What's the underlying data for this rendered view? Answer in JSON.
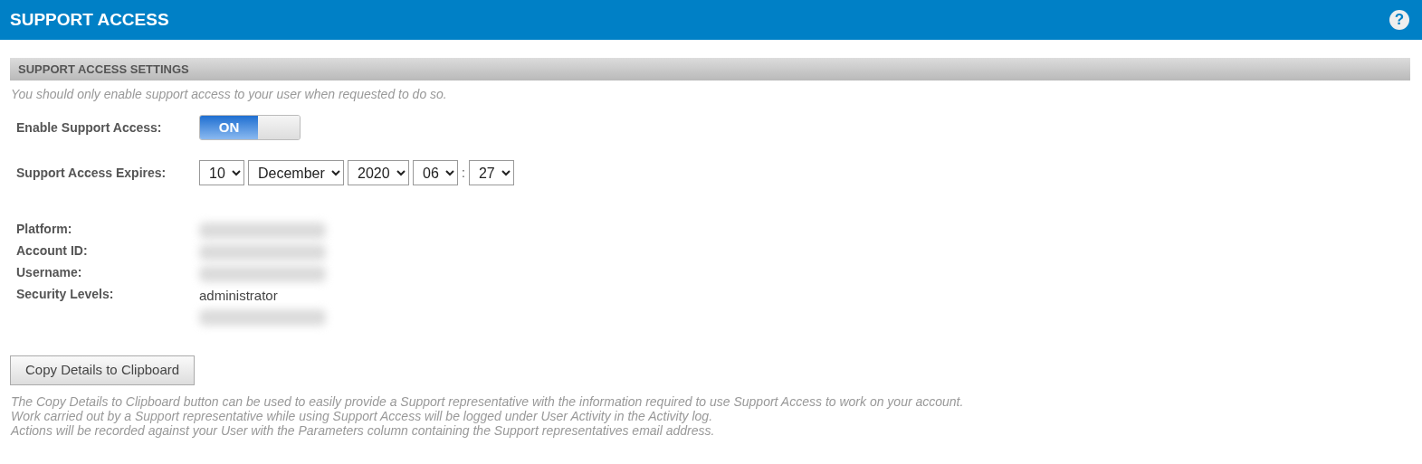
{
  "header": {
    "title": "SUPPORT ACCESS",
    "help": "?"
  },
  "section": {
    "title": "SUPPORT ACCESS SETTINGS",
    "note": "You should only enable support access to your user when requested to do so."
  },
  "enable": {
    "label": "Enable Support Access:",
    "on": true,
    "on_text": "ON"
  },
  "expires": {
    "label": "Support Access Expires:",
    "separator": ":",
    "selects": [
      {
        "value": "10"
      },
      {
        "value": "December"
      },
      {
        "value": "2020"
      },
      {
        "value": "06"
      },
      {
        "value": "27"
      }
    ]
  },
  "details": [
    {
      "label": "Platform:",
      "values": [
        {
          "kind": "redacted"
        }
      ]
    },
    {
      "label": "Account ID:",
      "values": [
        {
          "kind": "redacted"
        }
      ]
    },
    {
      "label": "Username:",
      "values": [
        {
          "kind": "redacted"
        }
      ]
    },
    {
      "label": "Security Levels:",
      "values": [
        {
          "kind": "text",
          "text": "administrator"
        },
        {
          "kind": "redacted"
        }
      ]
    }
  ],
  "copy_button": "Copy Details to Clipboard",
  "footnotes": [
    "The Copy Details to Clipboard button can be used to easily provide a Support representative with the information required to use Support Access to work on your account.",
    "Work carried out by a Support representative while using Support Access will be logged under User Activity in the Activity log.",
    "Actions will be recorded against your User with the Parameters column containing the Support representatives email address."
  ]
}
